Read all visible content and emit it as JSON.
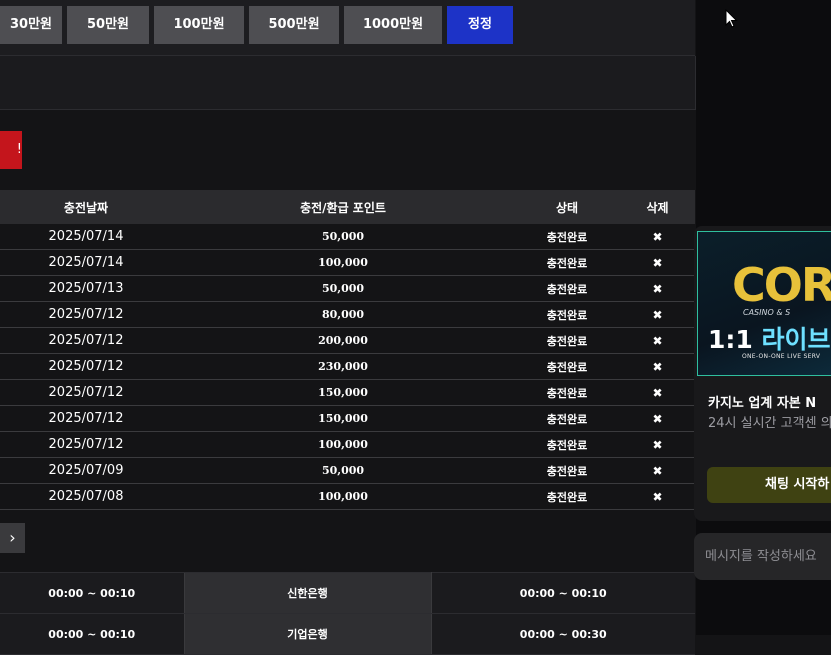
{
  "amount_buttons": [
    {
      "label": "30만원",
      "active": false
    },
    {
      "label": "50만원",
      "active": false
    },
    {
      "label": "100만원",
      "active": false
    },
    {
      "label": "500만원",
      "active": false
    },
    {
      "label": "1000만원",
      "active": false
    },
    {
      "label": "정정",
      "active": true
    }
  ],
  "history": {
    "headers": {
      "date": "충전날짜",
      "points": "충전/환급 포인트",
      "status": "상태",
      "delete": "삭제"
    },
    "rows": [
      {
        "date": "2025/07/14",
        "points": "50,000",
        "status": "충전완료",
        "del": "✖"
      },
      {
        "date": "2025/07/14",
        "points": "100,000",
        "status": "충전완료",
        "del": "✖"
      },
      {
        "date": "2025/07/13",
        "points": "50,000",
        "status": "충전완료",
        "del": "✖"
      },
      {
        "date": "2025/07/12",
        "points": "80,000",
        "status": "충전완료",
        "del": "✖"
      },
      {
        "date": "2025/07/12",
        "points": "200,000",
        "status": "충전완료",
        "del": "✖"
      },
      {
        "date": "2025/07/12",
        "points": "230,000",
        "status": "충전완료",
        "del": "✖"
      },
      {
        "date": "2025/07/12",
        "points": "150,000",
        "status": "충전완료",
        "del": "✖"
      },
      {
        "date": "2025/07/12",
        "points": "150,000",
        "status": "충전완료",
        "del": "✖"
      },
      {
        "date": "2025/07/12",
        "points": "100,000",
        "status": "충전완료",
        "del": "✖"
      },
      {
        "date": "2025/07/09",
        "points": "50,000",
        "status": "충전완료",
        "del": "✖"
      },
      {
        "date": "2025/07/08",
        "points": "100,000",
        "status": "충전완료",
        "del": "✖"
      }
    ]
  },
  "pager": {
    "next": "›"
  },
  "banks": [
    {
      "start": "00:00 ~ 00:10",
      "name": "신한은행",
      "end": "00:00 ~ 00:10"
    },
    {
      "start": "00:00 ~ 00:10",
      "name": "기업은행",
      "end": "00:00 ~ 00:30"
    }
  ],
  "chat": {
    "banner_logo": "COR",
    "banner_sub": "CASINO & S",
    "banner_title_a": "1:1 ",
    "banner_title_b": "라이브 고",
    "banner_caption": "ONE-ON-ONE LIVE SERV",
    "title": "카지노 업계 자본 N",
    "desc": "24시 실시간 고객센 의",
    "start_label": "채팅 시작하",
    "message_placeholder": "메시지를 작성하세요"
  },
  "colors": {
    "accent": "#1d33c7",
    "red": "#c4151c",
    "chat_button": "#3f4212"
  }
}
